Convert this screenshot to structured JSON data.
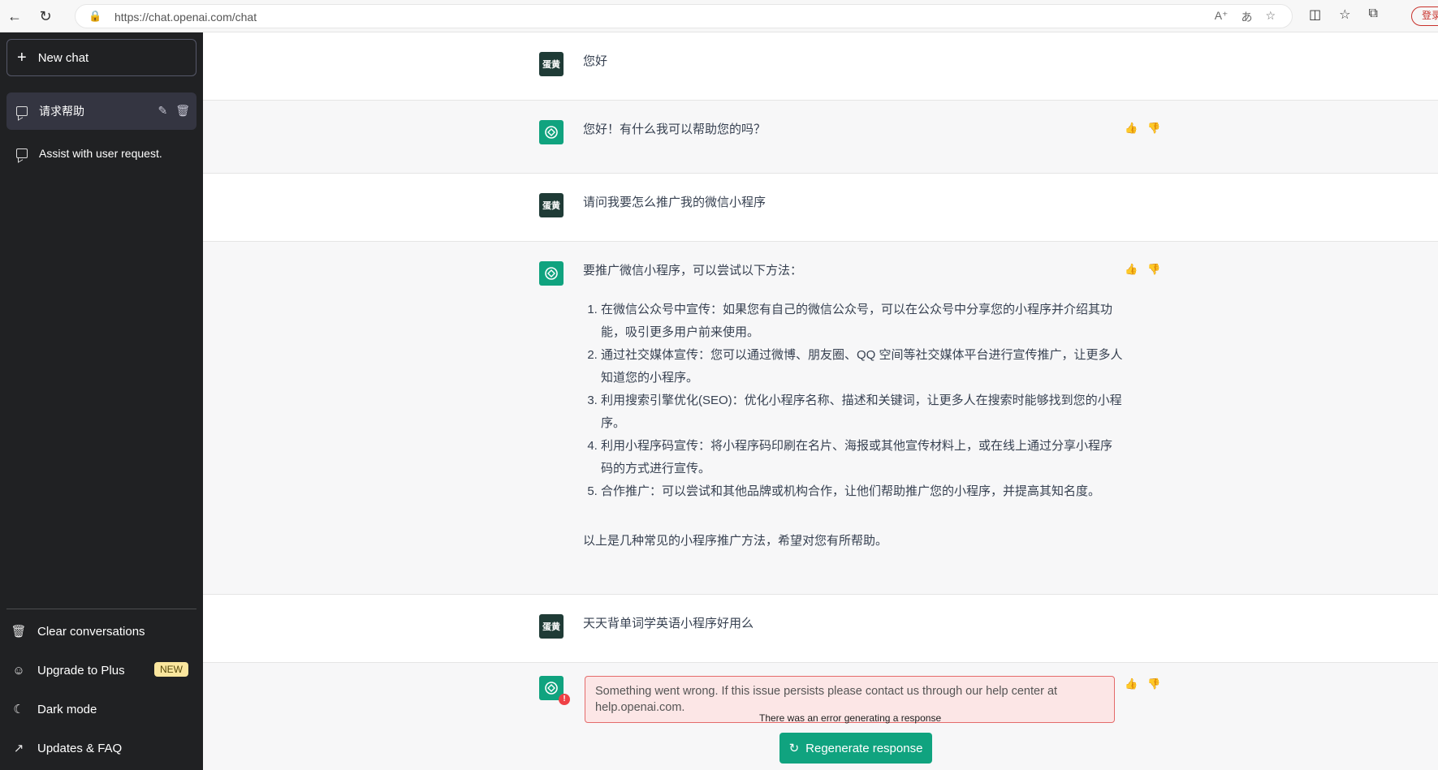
{
  "browser": {
    "url": "https://chat.openai.com/chat",
    "login_label": "登录"
  },
  "sidebar": {
    "new_chat": "New chat",
    "conversations": [
      {
        "title": "请求帮助",
        "active": true
      },
      {
        "title": "Assist with user request.",
        "active": false
      }
    ],
    "bottom": {
      "clear": "Clear conversations",
      "upgrade": "Upgrade to Plus",
      "upgrade_badge": "NEW",
      "dark_mode": "Dark mode",
      "updates": "Updates & FAQ"
    }
  },
  "user_avatar_label": "蛋黄",
  "messages": [
    {
      "role": "user",
      "text": "您好"
    },
    {
      "role": "assistant",
      "text": "您好！有什么我可以帮助您的吗？"
    },
    {
      "role": "user",
      "text": "请问我要怎么推广我的微信小程序"
    },
    {
      "role": "assistant",
      "intro": "要推广微信小程序，可以尝试以下方法：",
      "list": [
        "在微信公众号中宣传：如果您有自己的微信公众号，可以在公众号中分享您的小程序并介绍其功能，吸引更多用户前来使用。",
        "通过社交媒体宣传：您可以通过微博、朋友圈、QQ 空间等社交媒体平台进行宣传推广，让更多人知道您的小程序。",
        "利用搜索引擎优化(SEO)：优化小程序名称、描述和关键词，让更多人在搜索时能够找到您的小程序。",
        "利用小程序码宣传：将小程序码印刷在名片、海报或其他宣传材料上，或在线上通过分享小程序码的方式进行宣传。",
        "合作推广：可以尝试和其他品牌或机构合作，让他们帮助推广您的小程序，并提高其知名度。"
      ],
      "outro": "以上是几种常见的小程序推广方法，希望对您有所帮助。"
    },
    {
      "role": "user",
      "text": "天天背单词学英语小程序好用么"
    },
    {
      "role": "assistant",
      "error": "Something went wrong. If this issue persists please contact us through our help center at help.openai.com."
    }
  ],
  "error_caption": "There was an error generating a response",
  "regenerate_label": "Regenerate response"
}
